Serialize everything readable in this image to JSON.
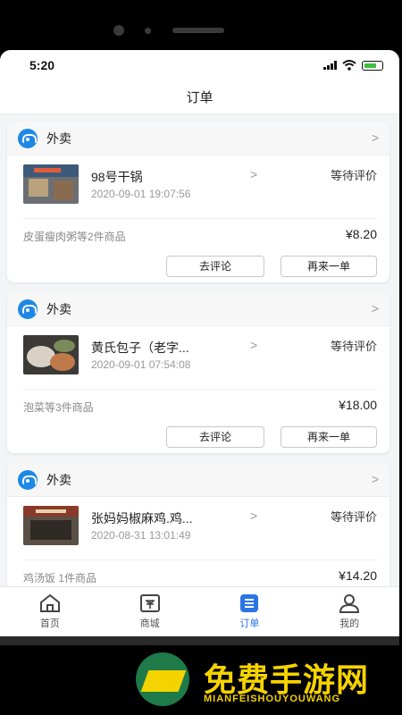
{
  "status_bar": {
    "time": "5:20"
  },
  "header": {
    "title": "订单"
  },
  "orders": [
    {
      "type": "外卖",
      "store": "98号干锅",
      "date": "2020-09-01 19:07:56",
      "status": "等待评价",
      "goods": "皮蛋瘦肉粥等2件商品",
      "price": "¥8.20",
      "review_label": "去评论",
      "reorder_label": "再来一单"
    },
    {
      "type": "外卖",
      "store": "黄氏包子（老字...",
      "date": "2020-09-01 07:54:08",
      "status": "等待评价",
      "goods": "泡菜等3件商品",
      "price": "¥18.00",
      "review_label": "去评论",
      "reorder_label": "再来一单"
    },
    {
      "type": "外卖",
      "store": "张妈妈椒麻鸡.鸡...",
      "date": "2020-08-31 13:01:49",
      "status": "等待评价",
      "goods": "鸡汤饭 1件商品",
      "price": "¥14.20"
    }
  ],
  "tabbar": {
    "items": [
      {
        "label": "首页",
        "icon": "home-icon"
      },
      {
        "label": "商城",
        "icon": "mall-icon"
      },
      {
        "label": "订单",
        "icon": "orders-icon",
        "active": true
      },
      {
        "label": "我的",
        "icon": "profile-icon"
      }
    ]
  },
  "watermark": {
    "title": "免费手游网",
    "subtitle": "MIANFEISHOUYOUWANG"
  },
  "colors": {
    "accent": "#2b74e4",
    "brand_icon": "#1e88e5",
    "watermark": "#f5d300"
  }
}
